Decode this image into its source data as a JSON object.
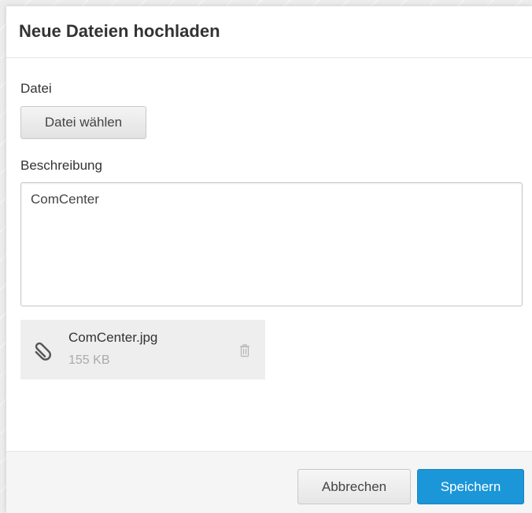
{
  "dialog": {
    "title": "Neue Dateien hochladen"
  },
  "form": {
    "file_label": "Datei",
    "choose_file_button": "Datei wählen",
    "description_label": "Beschreibung",
    "description_value": "ComCenter"
  },
  "attachment": {
    "file_name": "ComCenter.jpg",
    "file_size": "155 KB",
    "icon": "paperclip-icon",
    "delete_icon": "trash-icon"
  },
  "footer": {
    "cancel_label": "Abbrechen",
    "save_label": "Speichern"
  },
  "colors": {
    "primary": "#1b96d8",
    "file_card_bg": "#eeeeee",
    "footer_bg": "#f5f5f5"
  }
}
